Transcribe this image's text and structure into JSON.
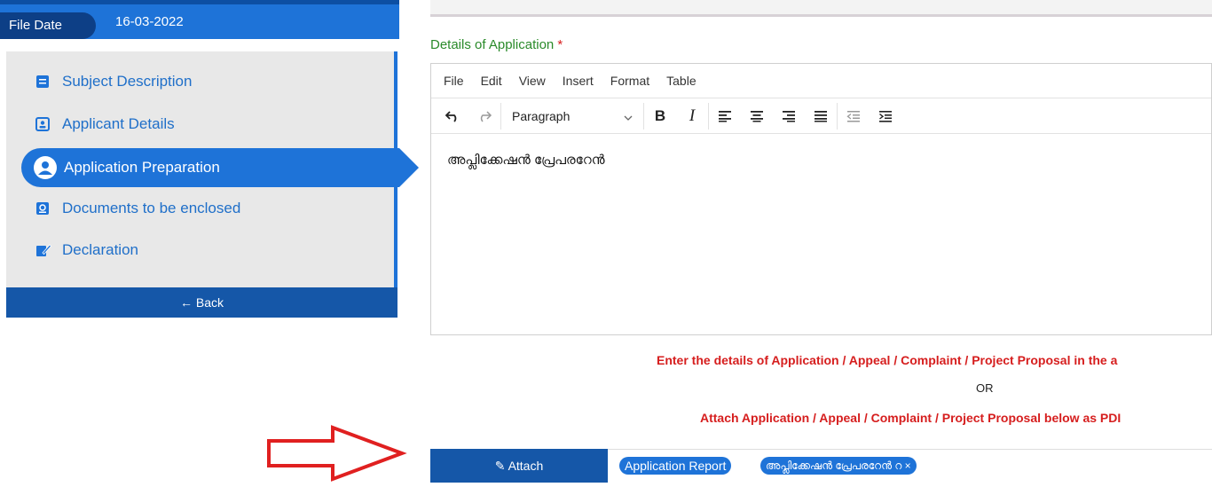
{
  "file_date": {
    "label": "File Date",
    "value": "16-03-2022"
  },
  "nav": {
    "items": [
      {
        "label": "Subject Description",
        "icon": "book-icon"
      },
      {
        "label": "Applicant Details",
        "icon": "id-card-icon"
      },
      {
        "label": "Application Preparation",
        "icon": "user-badge-icon",
        "active": true
      },
      {
        "label": "Documents to be enclosed",
        "icon": "document-icon"
      },
      {
        "label": "Declaration",
        "icon": "signature-icon"
      }
    ],
    "back_label": "← Back"
  },
  "form": {
    "details_label": "Details of Application",
    "required_mark": "*",
    "editor": {
      "menu": [
        "File",
        "Edit",
        "View",
        "Insert",
        "Format",
        "Table"
      ],
      "block_format": "Paragraph",
      "bold": "B",
      "italic": "I",
      "content": "അപ്ലിക്കേഷൻ പ്രേപരറേൻ"
    },
    "instruction_1": "Enter the details of Application / Appeal / Complaint / Project Proposal in the a",
    "or_text": "OR",
    "instruction_2": "Attach Application / Appeal / Complaint / Project Proposal below as PDI",
    "attach_label": "✎ Attach",
    "attachments": [
      {
        "label": "Application Report"
      },
      {
        "label": "അപ്ലിക്കേഷൻ പ്രേപരറേൻ റ ×"
      }
    ]
  },
  "colors": {
    "primary": "#1e73d8",
    "dark": "#1557a8",
    "alert": "#d61e1e",
    "success": "#2a8a2a"
  }
}
